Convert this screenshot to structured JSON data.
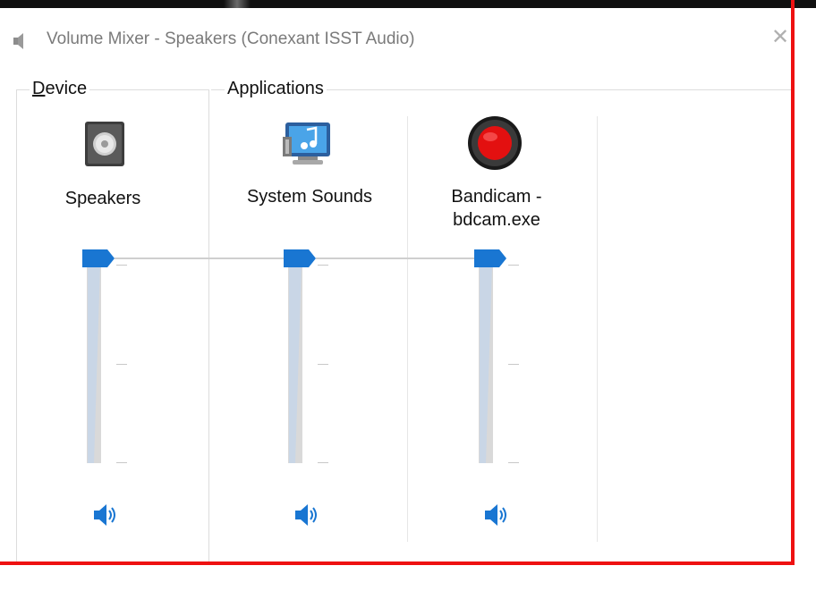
{
  "window": {
    "title": "Volume Mixer - Speakers (Conexant ISST Audio)",
    "title_icon": "speaker-icon",
    "close_icon": "close-icon",
    "close_label": "✕"
  },
  "device_group": {
    "legend_hotkey": "D",
    "legend_rest": "evice",
    "channels": [
      {
        "name": "Speakers",
        "icon": "speaker-device-icon",
        "volume_percent": 100,
        "mute_icon": "volume-icon"
      }
    ]
  },
  "applications_group": {
    "legend": "Applications",
    "channels": [
      {
        "name": "System Sounds",
        "icon": "system-sounds-icon",
        "volume_percent": 100,
        "mute_icon": "volume-icon"
      },
      {
        "name_line1": "Bandicam -",
        "name_line2": "bdcam.exe",
        "icon": "bandicam-record-icon",
        "volume_percent": 100,
        "mute_icon": "volume-icon"
      }
    ]
  },
  "colors": {
    "thumb": "#1976d2",
    "track": "#d9d9d9",
    "highlight_frame": "#ee1111",
    "title_text": "#7a7a7a"
  }
}
